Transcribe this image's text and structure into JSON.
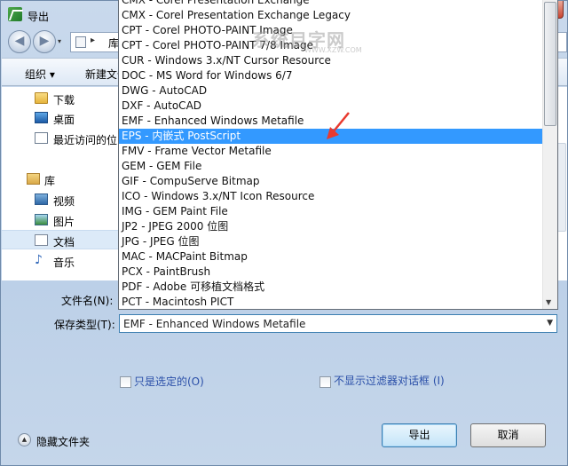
{
  "window": {
    "title": "导出",
    "close_glyph": "✕"
  },
  "nav": {
    "address_text": "库",
    "back_glyph": "◀",
    "forward_glyph": "▶",
    "history_glyph": "▾",
    "breadcrumb_glyph": "▸"
  },
  "toolbar": {
    "organize_label": "组织 ▾",
    "new_folder_label": "新建文件"
  },
  "sidebar": {
    "items": [
      {
        "label": "下载",
        "icon": "download-folder-icon"
      },
      {
        "label": "桌面",
        "icon": "desktop-icon"
      },
      {
        "label": "最近访问的位",
        "icon": "recent-places-icon"
      },
      {
        "label": "库",
        "icon": "libraries-icon"
      },
      {
        "label": "视频",
        "icon": "videos-icon"
      },
      {
        "label": "图片",
        "icon": "pictures-icon"
      },
      {
        "label": "文档",
        "icon": "documents-icon"
      },
      {
        "label": "音乐",
        "icon": "music-icon"
      }
    ]
  },
  "dropdown": {
    "options": [
      "CMX - Corel Presentation Exchange",
      "CMX - Corel Presentation Exchange Legacy",
      "CPT - Corel PHOTO-PAINT Image",
      "CPT - Corel PHOTO-PAINT 7/8 Image",
      "CUR - Windows 3.x/NT Cursor Resource",
      "DOC - MS Word for Windows 6/7",
      "DWG - AutoCAD",
      "DXF - AutoCAD",
      "EMF - Enhanced Windows Metafile",
      "EPS - 内嵌式 PostScript",
      "FMV - Frame Vector Metafile",
      "GEM - GEM File",
      "GIF - CompuServe Bitmap",
      "ICO - Windows 3.x/NT Icon Resource",
      "IMG - GEM Paint File",
      "JP2 - JPEG 2000 位图",
      "JPG - JPEG 位图",
      "MAC - MACPaint Bitmap",
      "PCX - PaintBrush",
      "PDF - Adobe 可移植文档格式",
      "PCT - Macintosh PICT"
    ],
    "highlighted": "EPS - 内嵌式 PostScript"
  },
  "fields": {
    "filename_label": "文件名(N):",
    "filetype_label": "保存类型(T):",
    "filetype_value": "EMF - Enhanced Windows Metafile"
  },
  "options": {
    "selected_only_label": "只是选定的(O)",
    "no_filter_dialog_label": "不显示过滤器对话框 (I)"
  },
  "footer": {
    "hide_folders_label": "隐藏文件夹",
    "export_label": "导出",
    "cancel_label": "取消"
  },
  "watermark": {
    "main": "系统目字网",
    "sub": "WWW.XZW.COM"
  },
  "colors": {
    "highlight": "#3399ff",
    "annotation_arrow": "#e83a2f"
  }
}
